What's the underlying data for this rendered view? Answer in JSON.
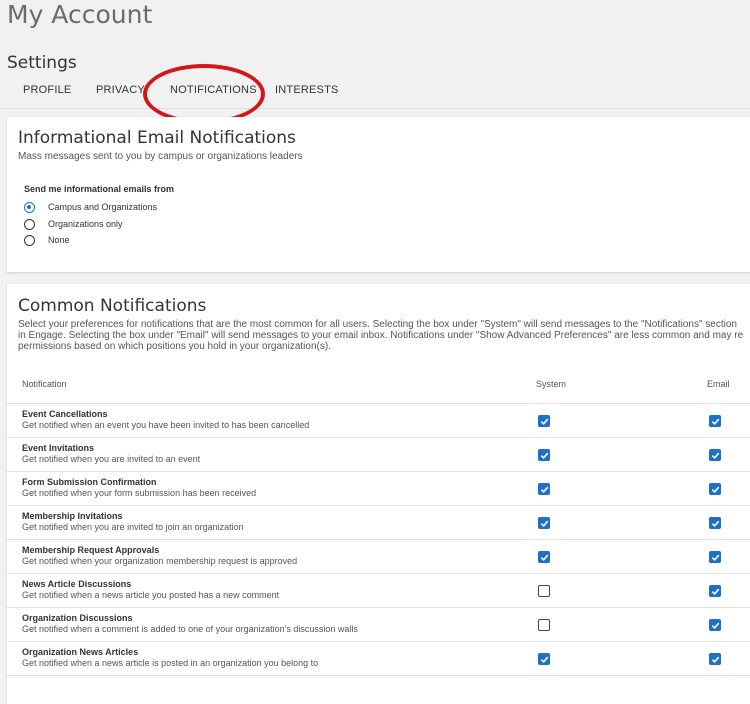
{
  "page_title": "My Account",
  "settings_title": "Settings",
  "tabs": [
    {
      "label": "PROFILE"
    },
    {
      "label": "PRIVACY"
    },
    {
      "label": "NOTIFICATIONS",
      "active": true,
      "annotation": "red circle"
    },
    {
      "label": "INTERESTS"
    }
  ],
  "informational": {
    "title": "Informational Email Notifications",
    "subtitle": "Mass messages sent to you by campus or organizations leaders",
    "prompt": "Send me informational emails from",
    "options": [
      {
        "label": "Campus and Organizations",
        "selected": true
      },
      {
        "label": "Organizations only",
        "selected": false
      },
      {
        "label": "None",
        "selected": false
      }
    ]
  },
  "common": {
    "title": "Common Notifications",
    "description_lines": [
      "Select your preferences for notifications that are the most common for all users. Selecting the box under \"System\" will send messages to the \"Notifications\" section",
      "in Engage. Selecting the box under \"Email\" will send messages to your email inbox. Notifications under \"Show Advanced Preferences\" are less common and may re",
      "permissions based on which positions you hold in your organization(s)."
    ],
    "columns": {
      "notification": "Notification",
      "system": "System",
      "email": "Email"
    },
    "rows": [
      {
        "title": "Event Cancellations",
        "desc": "Get notified when an event you have been invited to has been cancelled",
        "system": true,
        "email": true
      },
      {
        "title": "Event Invitations",
        "desc": "Get notified when you are invited to an event",
        "system": true,
        "email": true
      },
      {
        "title": "Form Submission Confirmation",
        "desc": "Get notified when your form submission has been received",
        "system": true,
        "email": true
      },
      {
        "title": "Membership Invitations",
        "desc": "Get notified when you are invited to join an organization",
        "system": true,
        "email": true
      },
      {
        "title": "Membership Request Approvals",
        "desc": "Get notified when your organization membership request is approved",
        "system": true,
        "email": true
      },
      {
        "title": "News Article Discussions",
        "desc": "Get notified when a news article you posted has a new comment",
        "system": false,
        "email": true
      },
      {
        "title": "Organization Discussions",
        "desc": "Get notified when a comment is added to one of your organization's discussion walls",
        "system": false,
        "email": true
      },
      {
        "title": "Organization News Articles",
        "desc": "Get notified when a news article is posted in an organization you belong to",
        "system": true,
        "email": true
      }
    ]
  },
  "colors": {
    "accent": "#1e6fc6",
    "annotation": "#d4161c"
  }
}
